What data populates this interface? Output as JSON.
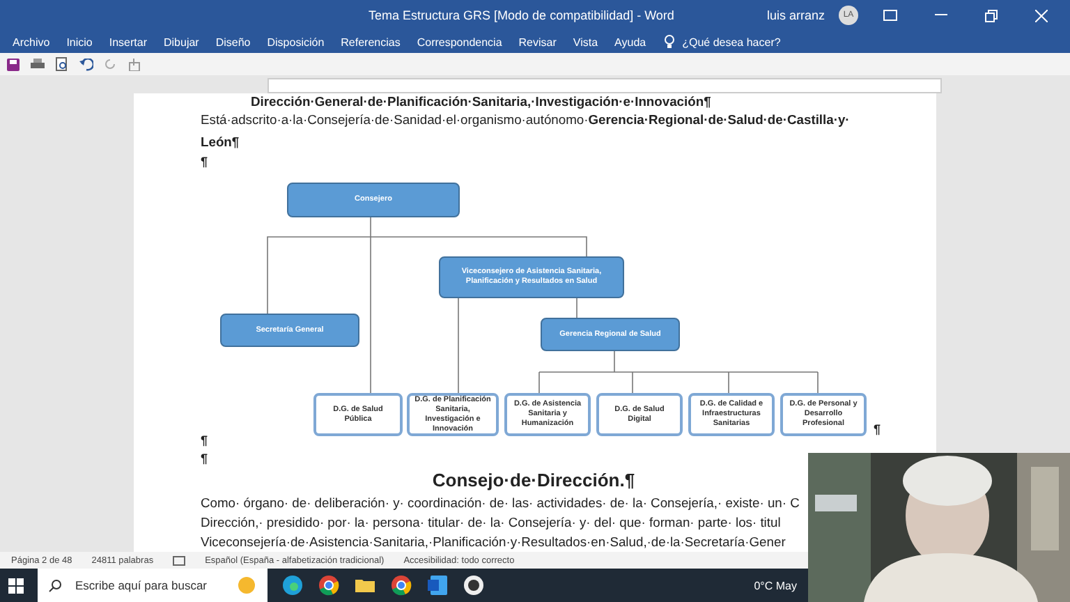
{
  "window": {
    "title": "Tema  Estructura GRS [Modo de compatibilidad]  -  Word",
    "user": "luis arranz",
    "avatar": "LA"
  },
  "ribbon_tabs": [
    {
      "label": "Archivo",
      "selected": false
    },
    {
      "label": "Inicio",
      "selected": false
    },
    {
      "label": "Insertar",
      "selected": false
    },
    {
      "label": "Dibujar",
      "selected": false
    },
    {
      "label": "Diseño",
      "selected": false
    },
    {
      "label": "Disposición",
      "selected": false
    },
    {
      "label": "Referencias",
      "selected": false
    },
    {
      "label": "Correspondencia",
      "selected": false
    },
    {
      "label": "Revisar",
      "selected": false
    },
    {
      "label": "Vista",
      "selected": false
    },
    {
      "label": "Ayuda",
      "selected": false
    }
  ],
  "tell_me": "¿Qué desea hacer?",
  "document": {
    "heading_cut": "Dirección·General·de·Planificación·Sanitaria,·Investigación·e·Innovación¶",
    "paragraph_lines": [
      "Está·adscrito·a·la·Consejería·de·Sanidad·el·organismo·autónomo·**Gerencia·Regional·de·Salud·de·Castilla·y·**",
      "**León¶**"
    ],
    "empty_mark": "¶",
    "org_chart": {
      "top": "Consejero",
      "vice": "Viceconsejero de Asistencia Sanitaria, Planificación y Resultados en Salud",
      "secretaria": "Secretaría General",
      "gerencia": "Gerencia Regional de Salud",
      "directorates": [
        "D.G. de Salud Pública",
        "D.G. de Planificación Sanitaria, Investigación e Innovación",
        "D.G. de Asistencia Sanitaria y Humanización",
        "D.G. de Salud Digital",
        "D.G. de Calidad e Infraestructuras Sanitarias",
        "D.G. de Personal y Desarrollo Profesional"
      ],
      "end_mark": "¶"
    },
    "marks_after": [
      "¶",
      "¶"
    ],
    "section_title": "Consejo·de·Dirección.¶",
    "body_lines": [
      "Como· órgano· de· deliberación· y· coordinación· de· las· actividades· de· la· Consejería,· existe· un· C",
      "Dirección,· presidido· por· la· persona· titular· de· la· Consejería· y· del· que· forman· parte· los· titul",
      "Viceconsejería·de·Asistencia·Sanitaria,·Planificación·y·Resultados·en·Salud,·de·la·Secretaría·Gener"
    ]
  },
  "status_bar": {
    "page": "Página 2 de 48",
    "words": "24811 palabras",
    "language": "Español (España - alfabetización tradicional)",
    "accessibility": "Accesibilidad: todo correcto"
  },
  "taskbar": {
    "search_placeholder": "Escribe aquí para buscar",
    "temperature": "0°C",
    "date_cut": "May"
  }
}
